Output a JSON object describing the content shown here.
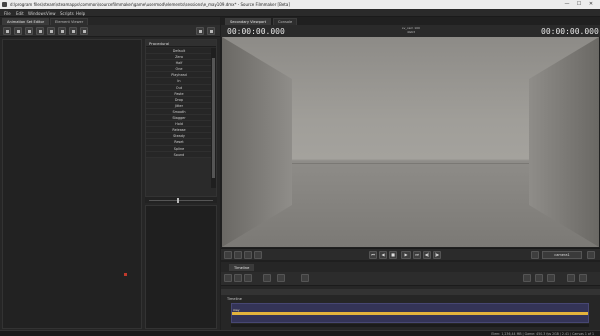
{
  "window": {
    "title": "d:\\program files\\steam\\steamapps\\common\\sourcefilmmaker\\game\\usermod\\elements\\sessions\\e_may109.dmx* - Source Filmmaker [Beta]",
    "controls": [
      "—",
      "☐",
      "✕"
    ]
  },
  "menu": [
    "File",
    "Edit",
    "Windows",
    "View",
    "Scripts",
    "Help"
  ],
  "left_panel": {
    "tabs": [
      "Animation Set Editor",
      "Element Viewer"
    ],
    "presets_header": "Procedural",
    "presets": [
      "Default",
      "Zero",
      "Half",
      "One",
      "Playhead",
      "In",
      "Out",
      "Paste",
      "Drop",
      "Jitter",
      "Smooth",
      "Stagger",
      "Hold",
      "Release",
      "Steady",
      "Reset",
      "Spline",
      "Sound"
    ]
  },
  "viewport": {
    "tabs": [
      "Secondary Viewport",
      "Console"
    ],
    "timecode_left": "00:00:00.000",
    "timecode_right": "00:00:00.000",
    "center_line1": "sv_cam 100",
    "center_line2": "4GK3",
    "camera_select": "camera1",
    "playback_buttons": [
      "⏮",
      "◀",
      "■",
      "▶",
      "⏭",
      "◀|",
      "|▶"
    ]
  },
  "timeline": {
    "tab": "Timeline",
    "track_label": "Timeline",
    "clip_name": "may"
  },
  "status": {
    "text": "Elem: 1,236,44 MB | Game: 450.3 fps 2GB / 2.41 / Canvas   1 of 1"
  },
  "colors": {
    "clip_band": "#e3b33c",
    "clip_bg": "#343457",
    "panel": "#262626"
  }
}
